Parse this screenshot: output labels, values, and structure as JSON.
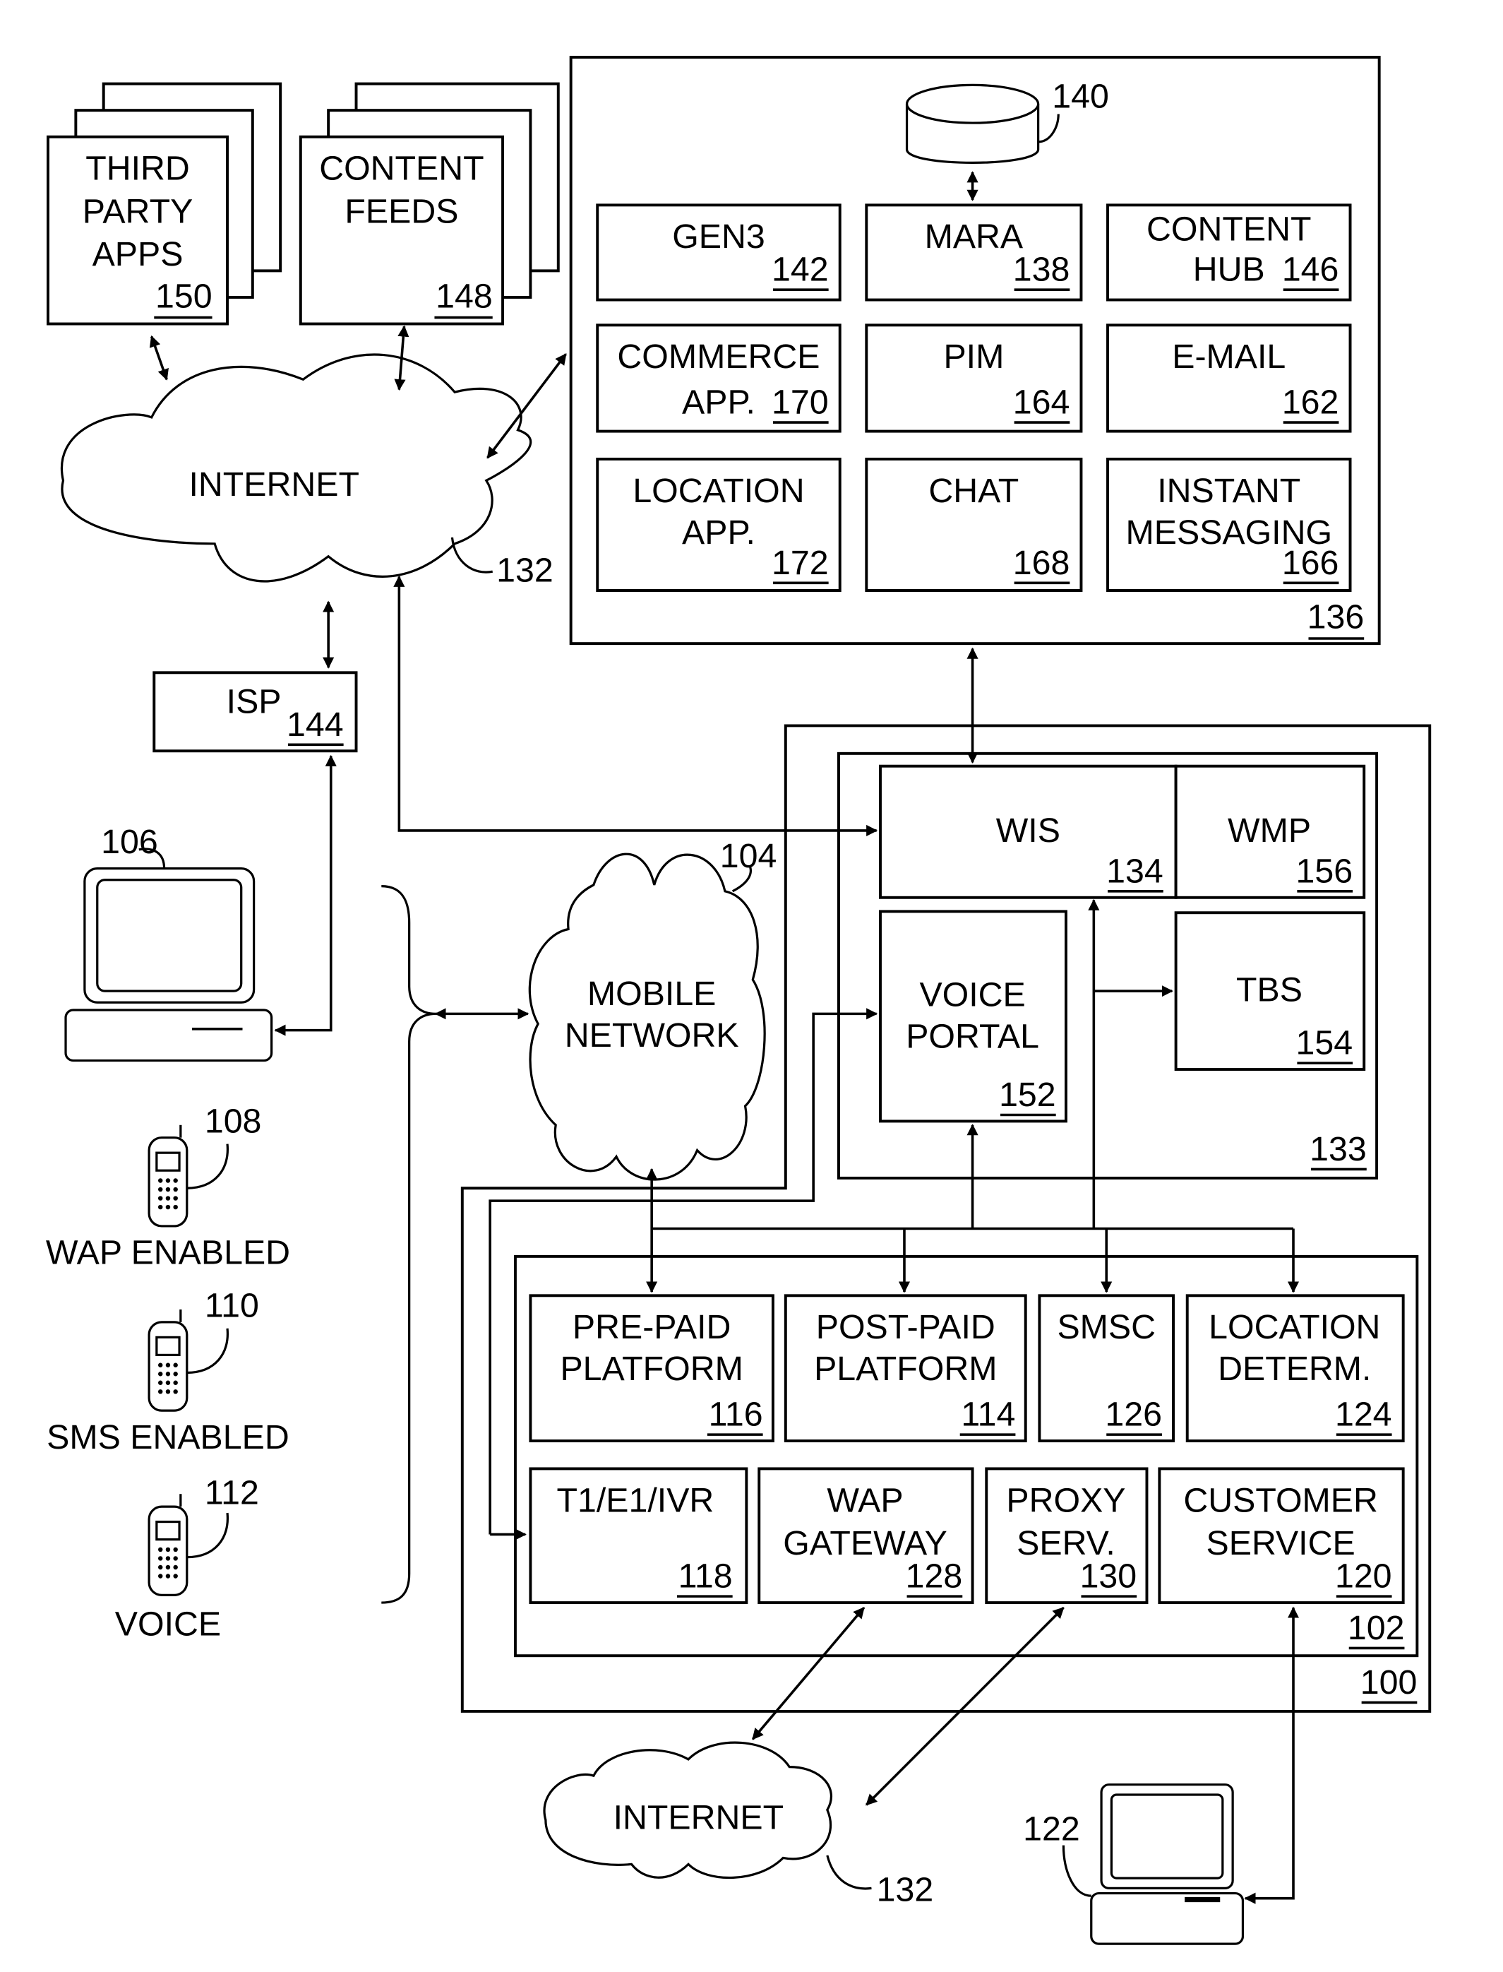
{
  "title": "System architecture block diagram",
  "nodes": {
    "third_party_apps": {
      "label": [
        "THIRD",
        "PARTY",
        "APPS"
      ],
      "ref": "150"
    },
    "content_feeds": {
      "label": [
        "CONTENT",
        "FEEDS"
      ],
      "ref": "148"
    },
    "internet_top": {
      "label": [
        "INTERNET"
      ],
      "ref": "132"
    },
    "isp": {
      "label": [
        "ISP"
      ],
      "ref": "144"
    },
    "server_group": {
      "ref": "136"
    },
    "database": {
      "ref": "140"
    },
    "gen3": {
      "label": [
        "GEN3"
      ],
      "ref": "142"
    },
    "mara": {
      "label": [
        "MARA"
      ],
      "ref": "138"
    },
    "content_hub": {
      "label": [
        "CONTENT",
        "HUB"
      ],
      "ref": "146"
    },
    "commerce_app": {
      "label": [
        "COMMERCE",
        "APP."
      ],
      "ref": "170"
    },
    "pim": {
      "label": [
        "PIM"
      ],
      "ref": "164"
    },
    "email": {
      "label": [
        "E-MAIL"
      ],
      "ref": "162"
    },
    "location_app": {
      "label": [
        "LOCATION",
        "APP."
      ],
      "ref": "172"
    },
    "chat": {
      "label": [
        "CHAT"
      ],
      "ref": "168"
    },
    "instant_messaging": {
      "label": [
        "INSTANT",
        "MESSAGING"
      ],
      "ref": "166"
    },
    "computer_106": {
      "ref": "106"
    },
    "mobile_network": {
      "label": [
        "MOBILE",
        "NETWORK"
      ],
      "ref": "104"
    },
    "phone_wap": {
      "label": [
        "WAP ENABLED"
      ],
      "ref": "108"
    },
    "phone_sms": {
      "label": [
        "SMS ENABLED"
      ],
      "ref": "110"
    },
    "phone_voice": {
      "label": [
        "VOICE"
      ],
      "ref": "112"
    },
    "outer_system": {
      "ref": "100"
    },
    "wis_group": {
      "ref": "133"
    },
    "wis": {
      "label": [
        "WIS"
      ],
      "ref": "134"
    },
    "wmp": {
      "label": [
        "WMP"
      ],
      "ref": "156"
    },
    "voice_portal": {
      "label": [
        "VOICE",
        "PORTAL"
      ],
      "ref": "152"
    },
    "tbs": {
      "label": [
        "TBS"
      ],
      "ref": "154"
    },
    "carrier_group": {
      "ref": "102"
    },
    "prepaid": {
      "label": [
        "PRE-PAID",
        "PLATFORM"
      ],
      "ref": "116"
    },
    "postpaid": {
      "label": [
        "POST-PAID",
        "PLATFORM"
      ],
      "ref": "114"
    },
    "smsc": {
      "label": [
        "SMSC"
      ],
      "ref": "126"
    },
    "location_determ": {
      "label": [
        "LOCATION",
        "DETERM."
      ],
      "ref": "124"
    },
    "t1e1ivr": {
      "label": [
        "T1/E1/IVR"
      ],
      "ref": "118"
    },
    "wap_gateway": {
      "label": [
        "WAP",
        "GATEWAY"
      ],
      "ref": "128"
    },
    "proxy_serv": {
      "label": [
        "PROXY",
        "SERV."
      ],
      "ref": "130"
    },
    "customer_service": {
      "label": [
        "CUSTOMER",
        "SERVICE"
      ],
      "ref": "120"
    },
    "internet_bottom": {
      "label": [
        "INTERNET"
      ],
      "ref": "132"
    },
    "computer_122": {
      "ref": "122"
    }
  }
}
